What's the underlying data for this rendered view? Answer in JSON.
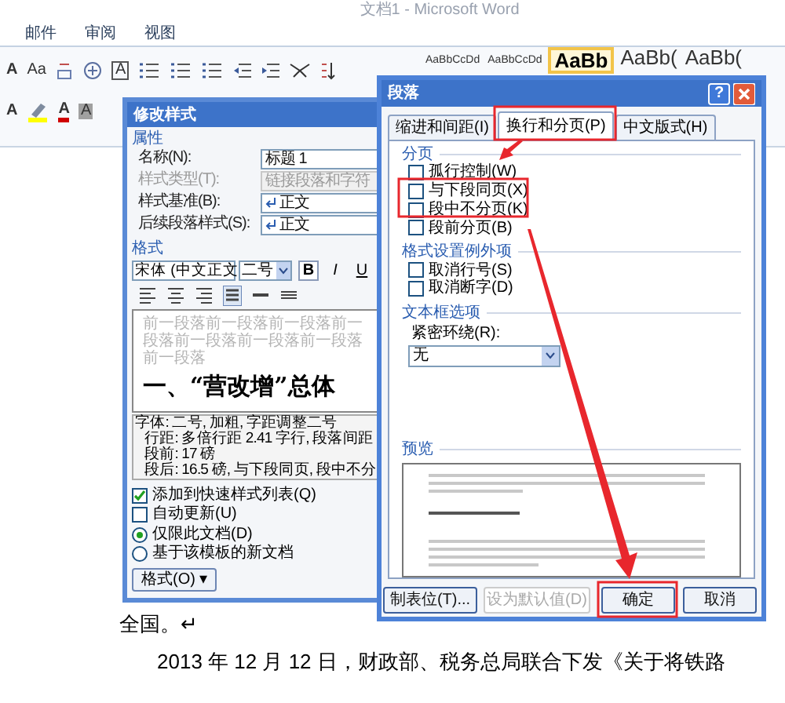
{
  "window": {
    "title": "文档1 - Microsoft Word"
  },
  "ribbon": {
    "tabs": [
      "邮件",
      "审阅",
      "视图"
    ],
    "letter_buttons": [
      "A",
      "Aa",
      "A",
      "A",
      "A",
      "A"
    ],
    "style_gallery": [
      {
        "label": "AaBbCcDd",
        "selected": false
      },
      {
        "label": "AaBbCcDd",
        "selected": false
      },
      {
        "label": "AaBb",
        "selected": true
      },
      {
        "label": "AaBb(",
        "selected": false
      },
      {
        "label": "AaBb(",
        "selected": false
      }
    ]
  },
  "document": {
    "paragraphs": [
      {
        "text": "全国。↵",
        "indent": false
      },
      {
        "text": "2013 年 12 月 12 日，财政部、税务总局联合下发《关于将铁路",
        "indent": true
      }
    ]
  },
  "modify_style_dialog": {
    "title": "修改样式",
    "properties_heading": "属性",
    "fields": [
      {
        "label": "名称(N):",
        "value": "标题 1",
        "disabled": false,
        "mark": false
      },
      {
        "label": "样式类型(T):",
        "value": "链接段落和字符",
        "disabled": true,
        "mark": false
      },
      {
        "label": "样式基准(B):",
        "value": "正文",
        "disabled": false,
        "mark": true
      },
      {
        "label": "后续段落样式(S):",
        "value": "正文",
        "disabled": false,
        "mark": true
      }
    ],
    "format_heading": "格式",
    "font": "宋体 (中文正文",
    "size": "二号",
    "font_buttons": [
      "B",
      "I",
      "U"
    ],
    "preview": {
      "previous_text": "前一段落前一段落前一段落前一段落前一段落前一段落前一段落前一段落",
      "heading": "一、“营改增”总体"
    },
    "description": [
      "字体: 二号, 加粗, 字距调整二号",
      "行距: 多倍行距 2.41 字行, 段落间距",
      "段前: 17 磅",
      "段后: 16.5 磅, 与下段同页, 段中不分"
    ],
    "checkboxes": [
      {
        "label": "添加到快速样式列表(Q)",
        "checked": true
      },
      {
        "label": "自动更新(U)",
        "checked": false
      }
    ],
    "radios": [
      {
        "label": "仅限此文档(D)",
        "selected": true
      },
      {
        "label": "基于该模板的新文档",
        "selected": false
      }
    ],
    "format_button": "格式(O) ▾"
  },
  "paragraph_dialog": {
    "title": "段落",
    "help_button": "?",
    "tabs": [
      {
        "label": "缩进和间距(I)",
        "selected": false
      },
      {
        "label": "换行和分页(P)",
        "selected": true
      },
      {
        "label": "中文版式(H)",
        "selected": false
      }
    ],
    "page_breaks": {
      "heading": "分页",
      "options": [
        {
          "label": "孤行控制(W)",
          "checked": false
        },
        {
          "label": "与下段同页(X)",
          "checked": false
        },
        {
          "label": "段中不分页(K)",
          "checked": false
        },
        {
          "label": "段前分页(B)",
          "checked": false
        }
      ]
    },
    "exceptions": {
      "heading": "格式设置例外项",
      "options": [
        {
          "label": "取消行号(S)",
          "checked": false
        },
        {
          "label": "取消断字(D)",
          "checked": false
        }
      ]
    },
    "textbox_options": {
      "heading": "文本框选项",
      "tight_wrap_label": "紧密环绕(R):",
      "tight_wrap_value": "无"
    },
    "preview_heading": "预览",
    "buttons": [
      {
        "label": "制表位(T)...",
        "disabled": false
      },
      {
        "label": "设为默认值(D)",
        "disabled": true
      },
      {
        "label": "确定",
        "disabled": false
      },
      {
        "label": "取消",
        "disabled": false
      }
    ]
  }
}
